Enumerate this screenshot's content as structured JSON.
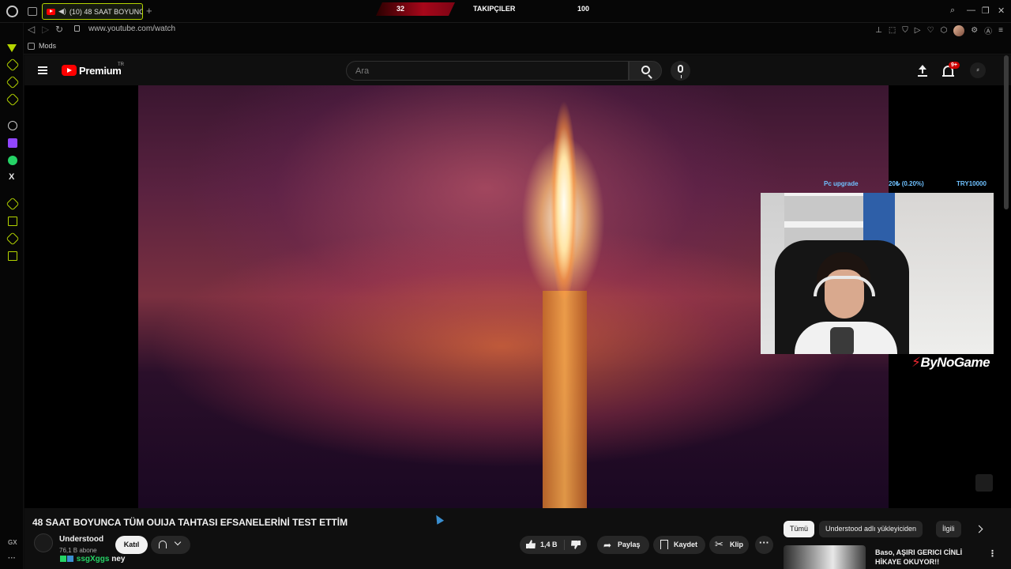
{
  "browser": {
    "tab_title": "(10) 48 SAAT BOYUNC",
    "url": "www.youtube.com/watch",
    "bookmark": "Mods",
    "sidebar_bottom_label": "GX",
    "accent_color": "#b4d400"
  },
  "stream_overlay": {
    "left_count": "32",
    "label": "TAKIPÇILER",
    "right_count": "100",
    "donation_title": "Pc upgrade",
    "donation_progress": "20₺ (0.20%)",
    "donation_goal": "TRY10000",
    "sponsor": "ByNoGame"
  },
  "youtube": {
    "brand": "Premium",
    "country": "TR",
    "search_placeholder": "Ara",
    "notification_count": "9+",
    "video_title": "48 SAAT BOYUNCA TÜM OUIJA TAHTASI EFSANELERİNİ TEST ETTİM",
    "channel_name": "Understood",
    "subscribers": "76,1 B abone",
    "join_label": "Katıl",
    "chat_user": "ssgXggs",
    "chat_message": "ney",
    "likes": "1,4 B",
    "share_label": "Paylaş",
    "save_label": "Kaydet",
    "clip_label": "Klip",
    "chips": [
      "Tümü",
      "Understood adlı yükleyiciden",
      "İlgili"
    ],
    "related_title": "Baso, AŞIRI GERICI CİNLİ HİKAYE OKUYOR!!"
  }
}
